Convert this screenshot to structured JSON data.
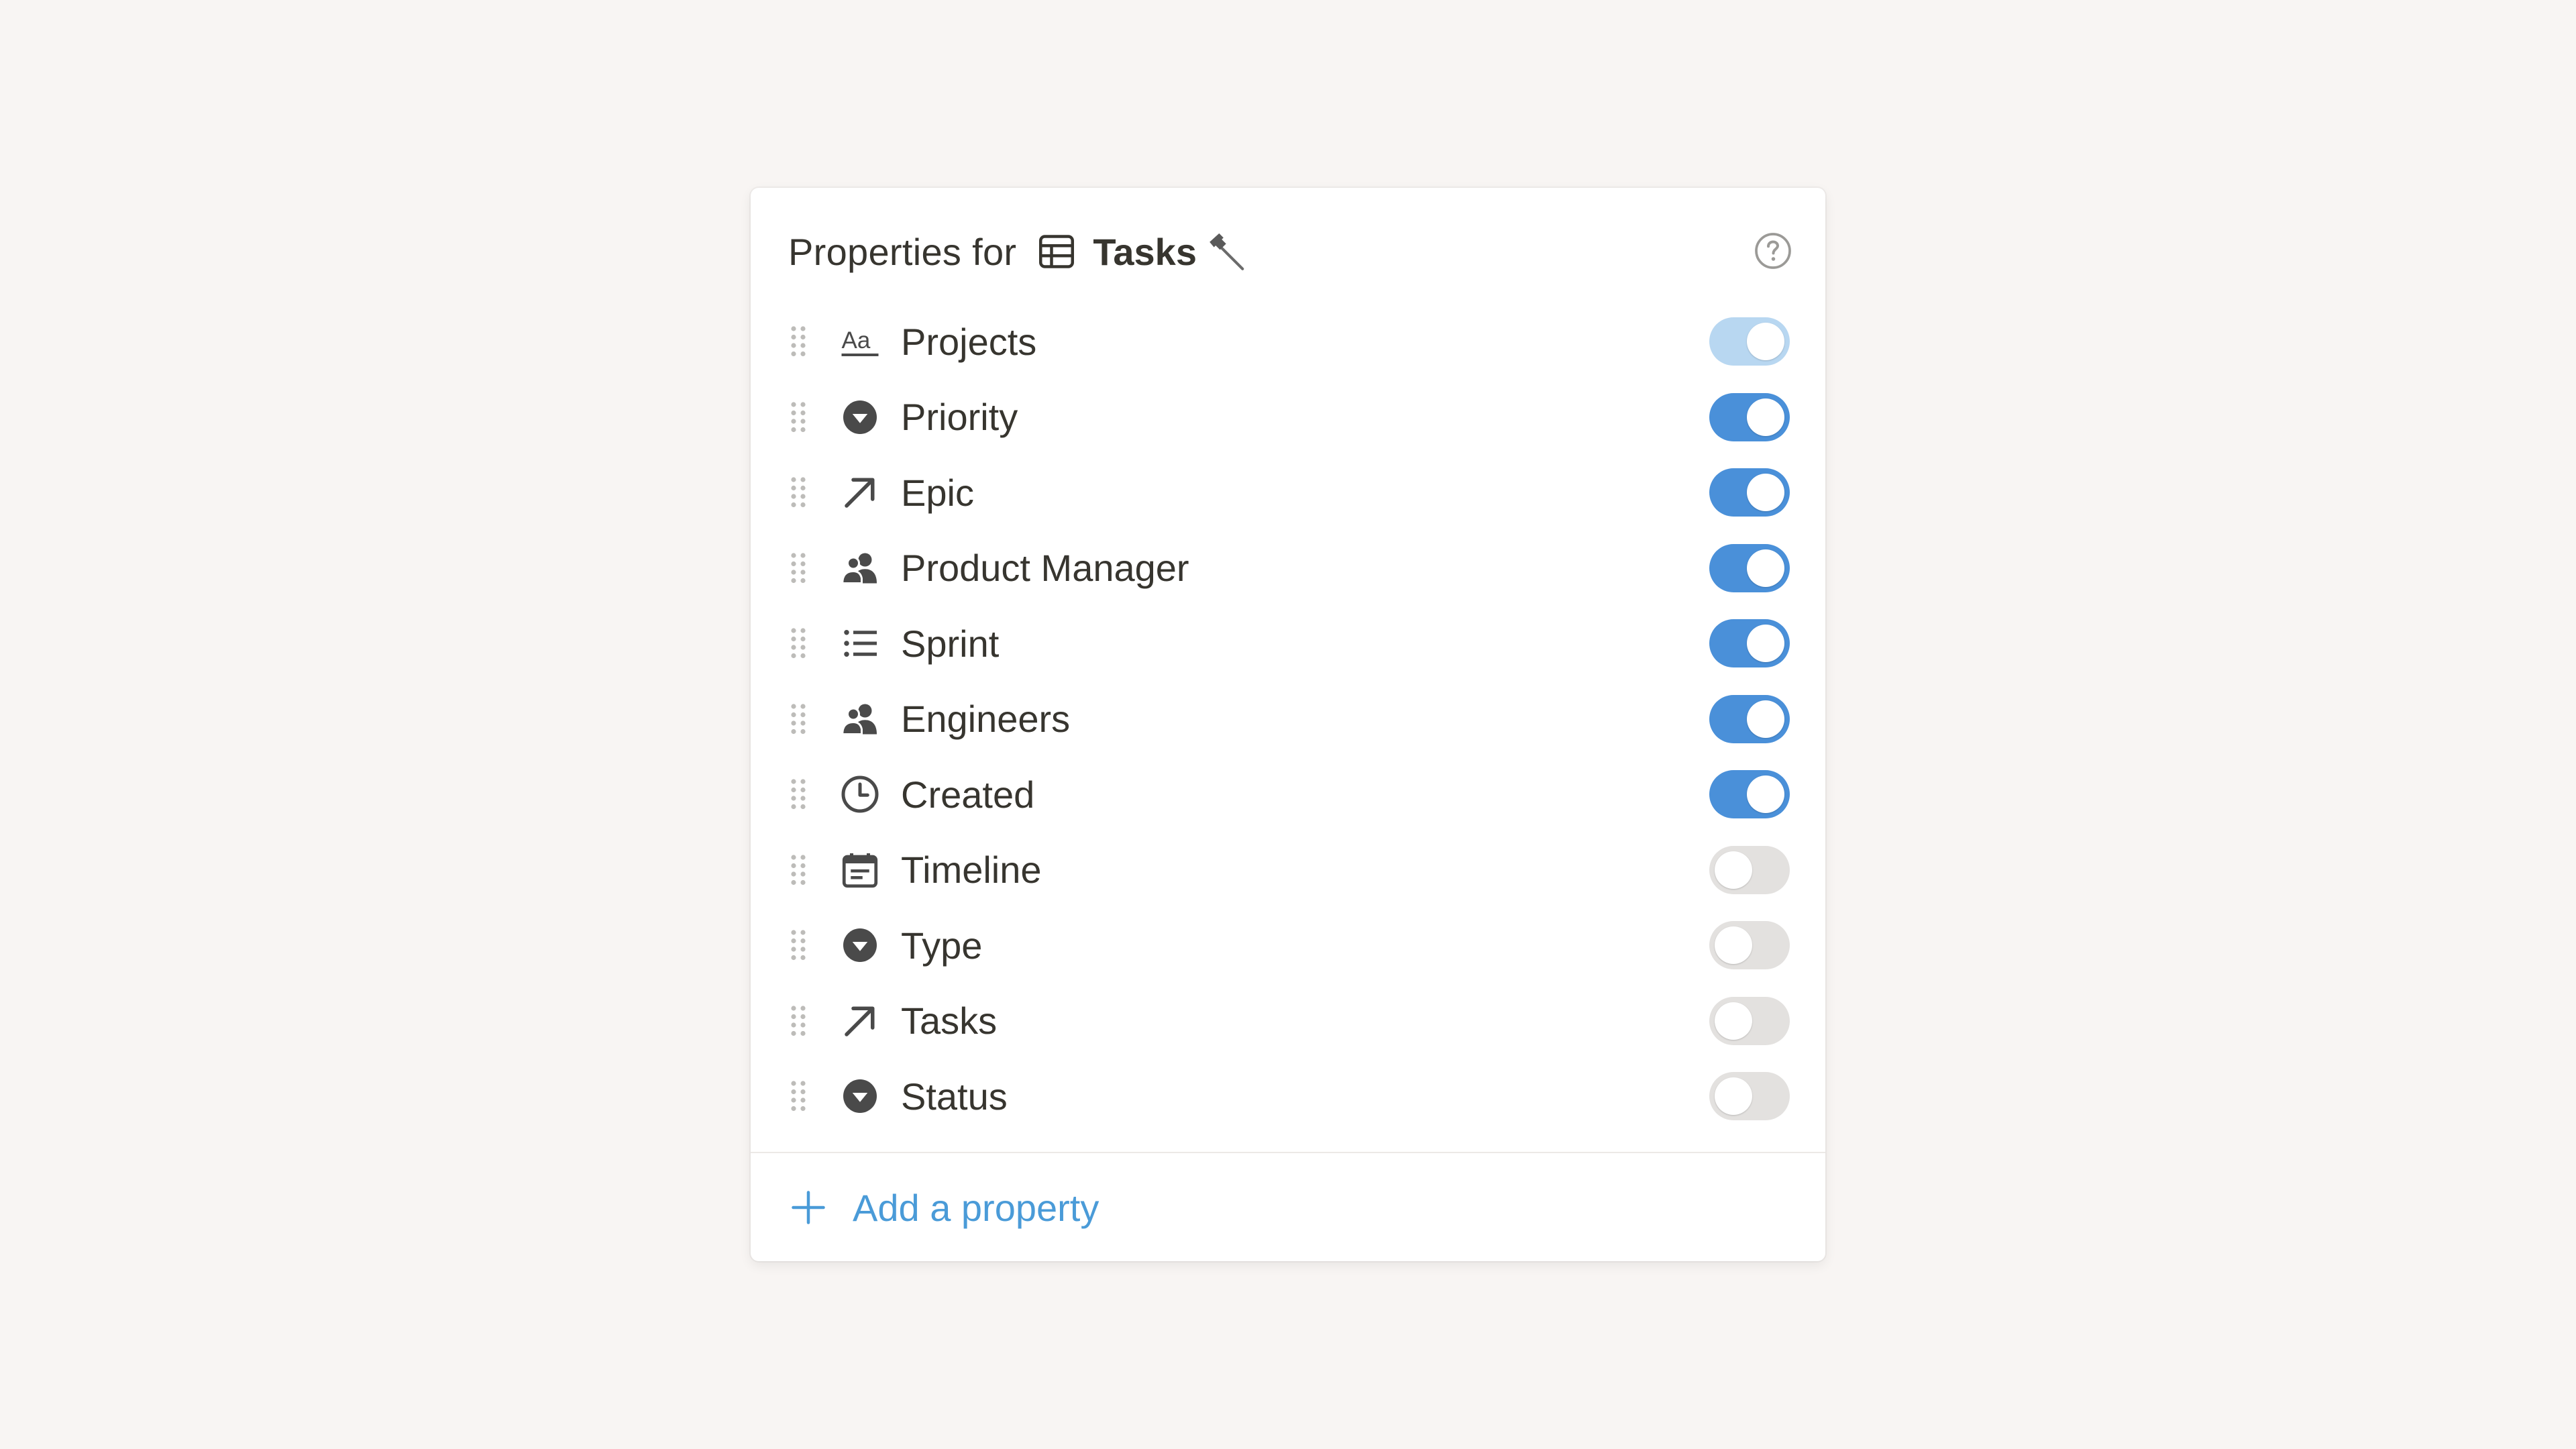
{
  "header": {
    "prefix": "Properties for",
    "database_icon": "table-icon",
    "database_name": "Tasks",
    "database_emoji": "hammer-icon",
    "help_icon": "help-circle-icon"
  },
  "properties": [
    {
      "label": "Projects",
      "icon": "text-aa-icon",
      "visible": true,
      "locked": true
    },
    {
      "label": "Priority",
      "icon": "select-icon",
      "visible": true
    },
    {
      "label": "Epic",
      "icon": "relation-arrow-icon",
      "visible": true
    },
    {
      "label": "Product Manager",
      "icon": "person-icon",
      "visible": true
    },
    {
      "label": "Sprint",
      "icon": "list-icon",
      "visible": true
    },
    {
      "label": "Engineers",
      "icon": "person-icon",
      "visible": true
    },
    {
      "label": "Created",
      "icon": "clock-icon",
      "visible": true
    },
    {
      "label": "Timeline",
      "icon": "calendar-icon",
      "visible": false
    },
    {
      "label": "Type",
      "icon": "select-icon",
      "visible": false
    },
    {
      "label": "Tasks",
      "icon": "relation-arrow-icon",
      "visible": false
    },
    {
      "label": "Status",
      "icon": "select-icon",
      "visible": false
    }
  ],
  "footer": {
    "add_label": "Add a property",
    "add_icon": "plus-icon"
  },
  "colors": {
    "toggle_on": "#4a90d9",
    "toggle_on_locked": "#b8d7f1",
    "toggle_off": "#e3e1df",
    "accent_link": "#4a9bd8",
    "background": "#f8f5f3"
  }
}
